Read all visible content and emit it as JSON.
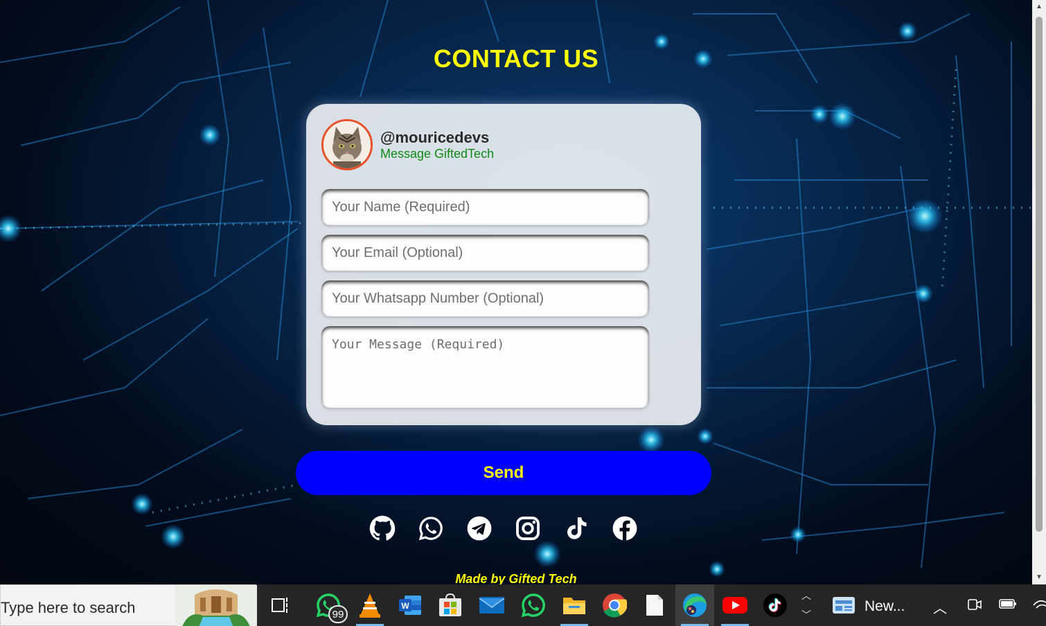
{
  "page": {
    "title": "CONTACT US",
    "footer": "Made by Gifted Tech"
  },
  "profile": {
    "handle": "@mouricedevs",
    "subtitle": "Message GiftedTech",
    "avatar_icon": "cat-avatar"
  },
  "form": {
    "name_placeholder": "Your Name (Required)",
    "email_placeholder": "Your Email (Optional)",
    "whatsapp_placeholder": "Your Whatsapp Number (Optional)",
    "message_placeholder": "Your Message (Required)"
  },
  "send_button": {
    "label": "Send"
  },
  "socials": [
    {
      "icon": "github-icon"
    },
    {
      "icon": "whatsapp-icon"
    },
    {
      "icon": "telegram-icon"
    },
    {
      "icon": "instagram-icon"
    },
    {
      "icon": "tiktok-icon"
    },
    {
      "icon": "facebook-icon"
    }
  ],
  "taskbar": {
    "search_placeholder": "Type here to search",
    "whatsapp_badge": "99",
    "news_label": "New...",
    "apps": [
      "task-view",
      "whatsapp",
      "vlc",
      "word",
      "microsoft-store",
      "mail",
      "whatsapp",
      "file-explorer",
      "chrome",
      "notepad",
      "edge",
      "youtube",
      "tiktok",
      "news"
    ]
  },
  "colors": {
    "title": "#ffff00",
    "send_button": "#0000ff",
    "send_text": "#ffff00",
    "subtitle": "#0d8a15",
    "avatar_ring": "#e8502a"
  }
}
